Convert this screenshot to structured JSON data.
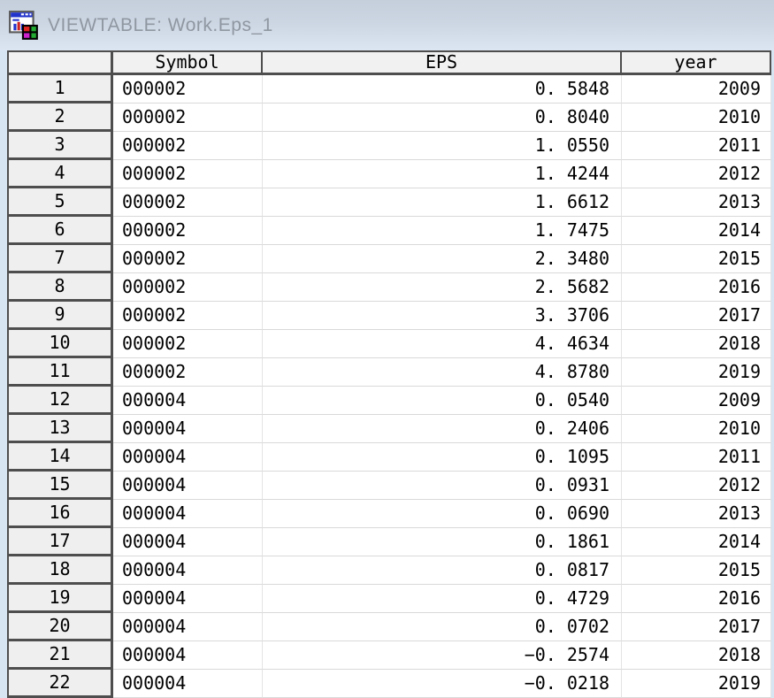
{
  "window": {
    "title": "VIEWTABLE: Work.Eps_1",
    "icon": "viewtable-icon"
  },
  "colors": {
    "titlebar_gradient_top": "#c5cfdc",
    "titlebar_gradient_bottom": "#dce6f2",
    "window_background": "#d7e5f3",
    "title_text": "#8f97a1",
    "header_background": "#f1f1f1",
    "row_number_background": "#efefef",
    "grid_dark_border": "#4e4e4e",
    "grid_light_border": "#d9d9d9",
    "cell_text": "#000000"
  },
  "table": {
    "columns": [
      {
        "key": "rownum",
        "label": ""
      },
      {
        "key": "symbol",
        "label": "Symbol"
      },
      {
        "key": "eps",
        "label": "EPS"
      },
      {
        "key": "year",
        "label": "year"
      }
    ],
    "rows": [
      [
        "1",
        "000002",
        "0.5848",
        "2009"
      ],
      [
        "2",
        "000002",
        "0.8040",
        "2010"
      ],
      [
        "3",
        "000002",
        "1.0550",
        "2011"
      ],
      [
        "4",
        "000002",
        "1.4244",
        "2012"
      ],
      [
        "5",
        "000002",
        "1.6612",
        "2013"
      ],
      [
        "6",
        "000002",
        "1.7475",
        "2014"
      ],
      [
        "7",
        "000002",
        "2.3480",
        "2015"
      ],
      [
        "8",
        "000002",
        "2.5682",
        "2016"
      ],
      [
        "9",
        "000002",
        "3.3706",
        "2017"
      ],
      [
        "10",
        "000002",
        "4.4634",
        "2018"
      ],
      [
        "11",
        "000002",
        "4.8780",
        "2019"
      ],
      [
        "12",
        "000004",
        "0.0540",
        "2009"
      ],
      [
        "13",
        "000004",
        "0.2406",
        "2010"
      ],
      [
        "14",
        "000004",
        "0.1095",
        "2011"
      ],
      [
        "15",
        "000004",
        "0.0931",
        "2012"
      ],
      [
        "16",
        "000004",
        "0.0690",
        "2013"
      ],
      [
        "17",
        "000004",
        "0.1861",
        "2014"
      ],
      [
        "18",
        "000004",
        "0.0817",
        "2015"
      ],
      [
        "19",
        "000004",
        "0.4729",
        "2016"
      ],
      [
        "20",
        "000004",
        "0.0702",
        "2017"
      ],
      [
        "21",
        "000004",
        "-0.2574",
        "2018"
      ],
      [
        "22",
        "000004",
        "-0.0218",
        "2019"
      ]
    ]
  }
}
